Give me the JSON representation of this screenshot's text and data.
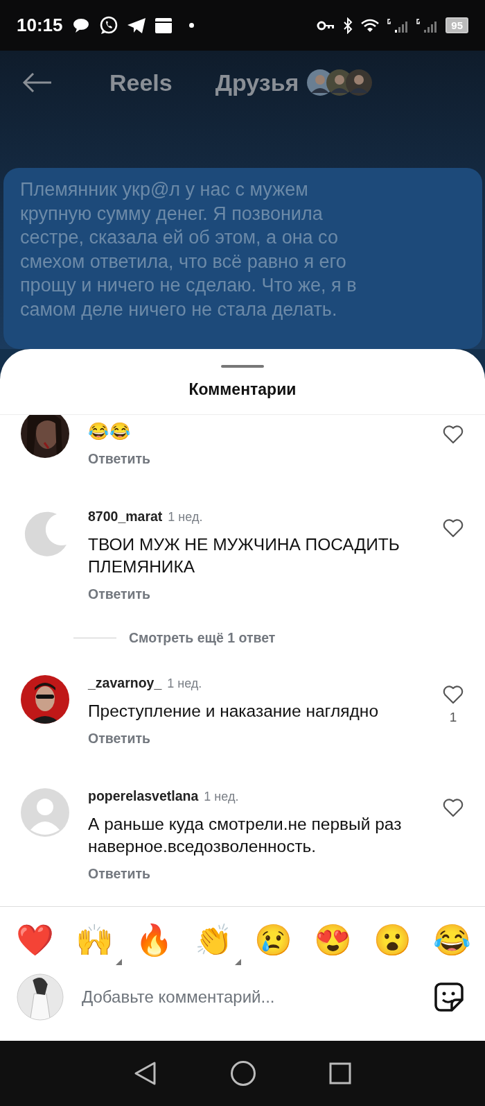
{
  "status_bar": {
    "time": "10:15",
    "battery": "95"
  },
  "header": {
    "tabs": [
      "Reels",
      "Друзья"
    ]
  },
  "post_text": "Племянник укр@л у нас с мужем крупную сумму денег. Я позвонила сестре, сказала ей об этом, а она со смехом ответила, что всё равно я его прощу и ничего не сделаю. Что же, я в самом деле ничего не стала делать.",
  "comments_sheet": {
    "title": "Комментарии",
    "comments": [
      {
        "text": "😂😂",
        "reply": "Ответить"
      },
      {
        "kind": "crescent",
        "username": "8700_marat",
        "time": "1 нед.",
        "text": "ТВОИ МУЖ НЕ МУЖЧИНА ПОСАДИТЬ ПЛЕМЯНИКА",
        "reply": "Ответить",
        "more_replies": "Смотреть ещё 1 ответ"
      },
      {
        "kind": "photo_red",
        "username": "_zavarnoy_",
        "time": "1 нед.",
        "text": "Преступление и наказание наглядно",
        "reply": "Ответить",
        "likes": "1"
      },
      {
        "kind": "default",
        "username": "poperelasvetlana",
        "time": "1 нед.",
        "text": "А раньше куда смотрели.не первый раз наверное.вседозволенность.",
        "reply": "Ответить"
      }
    ],
    "reactions": [
      {
        "emoji": "❤️",
        "more": false
      },
      {
        "emoji": "🙌",
        "more": true
      },
      {
        "emoji": "🔥",
        "more": false
      },
      {
        "emoji": "👏",
        "more": true
      },
      {
        "emoji": "😢",
        "more": false
      },
      {
        "emoji": "😍",
        "more": false
      },
      {
        "emoji": "😮",
        "more": false
      },
      {
        "emoji": "😂",
        "more": false
      }
    ],
    "input": {
      "placeholder": "Добавьте комментарий..."
    }
  }
}
